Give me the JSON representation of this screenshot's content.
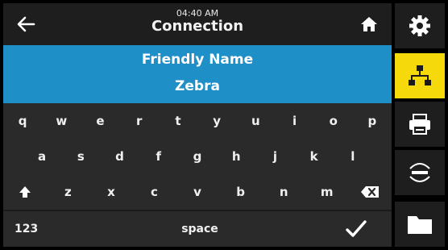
{
  "header": {
    "time": "04:40 AM",
    "title": "Connection",
    "back_icon": "back-arrow-icon",
    "home_icon": "home-icon"
  },
  "field": {
    "label": "Friendly Name",
    "value": "Zebra"
  },
  "keyboard": {
    "row1": [
      "q",
      "w",
      "e",
      "r",
      "t",
      "y",
      "u",
      "i",
      "o",
      "p"
    ],
    "row2": [
      "a",
      "s",
      "d",
      "f",
      "g",
      "h",
      "j",
      "k",
      "l"
    ],
    "row3": [
      "z",
      "x",
      "c",
      "v",
      "b",
      "n",
      "m"
    ],
    "numeric_label": "123",
    "space_label": "space",
    "shift_icon": "shift-icon",
    "backspace_icon": "backspace-icon",
    "done_icon": "checkmark-icon"
  },
  "sidebar": {
    "items": [
      {
        "icon": "gear-icon",
        "active": false
      },
      {
        "icon": "network-icon",
        "active": true
      },
      {
        "icon": "printer-icon",
        "active": false
      },
      {
        "icon": "sensor-icon",
        "active": false
      },
      {
        "icon": "folder-icon",
        "active": false
      }
    ]
  },
  "colors": {
    "field_bg": "#1f8fc7",
    "active_tab": "#f5d90a",
    "topbar_bg": "#1e1e1e",
    "keyboard_bg": "#2a2a2a"
  }
}
